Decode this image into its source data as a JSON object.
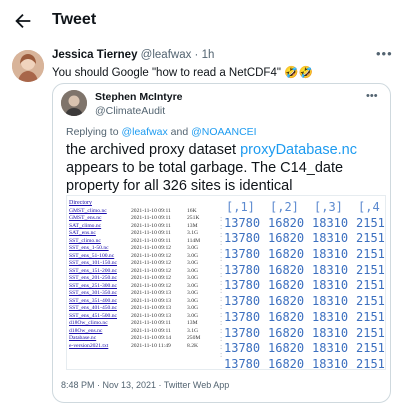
{
  "header": {
    "title": "Tweet",
    "back_icon": "arrow-left-icon"
  },
  "tweet": {
    "author_name": "Jessica Tierney",
    "author_handle": "@leafwax",
    "separator": "·",
    "time": "1h",
    "text": "You should Google \"how to read a NetCDF4\" 🤣🤣",
    "more_icon": "more-horizontal-icon"
  },
  "quote": {
    "author_name": "Stephen McIntyre",
    "author_handle": "@ClimateAudit",
    "reply_prefix": "Replying to ",
    "reply_handle_1": "@leafwax",
    "reply_and": " and ",
    "reply_handle_2": "@NOAANCEI",
    "text_part1": "the archived proxy dataset ",
    "text_link": "proxyDatabase.nc",
    "text_part2": " appears to be total garbage. The C14_date property for all 326 sites is identical",
    "footer": "8:48 PM · Nov 13, 2021 · Twitter Web App",
    "media": {
      "directory_label": "Directory",
      "files": [
        {
          "name": "GMST_climo.nc",
          "date": "2021-11-10 09:11",
          "size": "16K"
        },
        {
          "name": "GMST_ens.nc",
          "date": "2021-11-10 09:11",
          "size": "251K"
        },
        {
          "name": "SAT_climo.nc",
          "date": "2021-11-10 09:11",
          "size": "13M"
        },
        {
          "name": "SAT_ens.nc",
          "date": "2021-11-10 09:11",
          "size": "3.1G"
        },
        {
          "name": "SST_climo.nc",
          "date": "2021-11-10 09:11",
          "size": "114M"
        },
        {
          "name": "SST_ens_1-50.nc",
          "date": "2021-11-10 09:12",
          "size": "3.0G"
        },
        {
          "name": "SST_ens_51-100.nc",
          "date": "2021-11-10 09:12",
          "size": "3.0G"
        },
        {
          "name": "SST_ens_101-150.nc",
          "date": "2021-11-10 09:12",
          "size": "3.0G"
        },
        {
          "name": "SST_ens_151-200.nc",
          "date": "2021-11-10 09:12",
          "size": "3.0G"
        },
        {
          "name": "SST_ens_201-250.nc",
          "date": "2021-11-10 09:12",
          "size": "3.0G"
        },
        {
          "name": "SST_ens_251-300.nc",
          "date": "2021-11-10 09:12",
          "size": "3.0G"
        },
        {
          "name": "SST_ens_301-350.nc",
          "date": "2021-11-10 09:13",
          "size": "3.0G"
        },
        {
          "name": "SST_ens_351-400.nc",
          "date": "2021-11-10 09:13",
          "size": "3.0G"
        },
        {
          "name": "SST_ens_401-450.nc",
          "date": "2021-11-10 09:13",
          "size": "3.0G"
        },
        {
          "name": "SST_ens_451-500.nc",
          "date": "2021-11-10 09:13",
          "size": "3.0G"
        },
        {
          "name": "d18Ow_climo.nc",
          "date": "2021-11-10 09:11",
          "size": "13M"
        },
        {
          "name": "d18Ow_ens.nc",
          "date": "2021-11-10 09:11",
          "size": "3.1G"
        },
        {
          "name": "Database.nc",
          "date": "2021-11-10 09:14",
          "size": "250M"
        },
        {
          "name": "e-version2021.txt",
          "date": "2021-11-10 11:49",
          "size": "8.2K"
        }
      ],
      "column_headers": [
        "[,1]",
        "[,2]",
        "[,3]",
        "[,4"
      ],
      "rows": [
        [
          "13780",
          "16820",
          "18310",
          "2151"
        ],
        [
          "13780",
          "16820",
          "18310",
          "2151"
        ],
        [
          "13780",
          "16820",
          "18310",
          "2151"
        ],
        [
          "13780",
          "16820",
          "18310",
          "2151"
        ],
        [
          "13780",
          "16820",
          "18310",
          "2151"
        ],
        [
          "13780",
          "16820",
          "18310",
          "2151"
        ],
        [
          "13780",
          "16820",
          "18310",
          "2151"
        ],
        [
          "13780",
          "16820",
          "18310",
          "2151"
        ],
        [
          "13780",
          "16820",
          "18310",
          "2151"
        ],
        [
          "13780",
          "16820",
          "18310",
          "2151"
        ]
      ],
      "link_color": "#1a0dab",
      "value_color": "#3b6fbf"
    }
  },
  "colors": {
    "link": "#1d9bf0",
    "muted": "#536471",
    "border": "#cfd9de"
  }
}
